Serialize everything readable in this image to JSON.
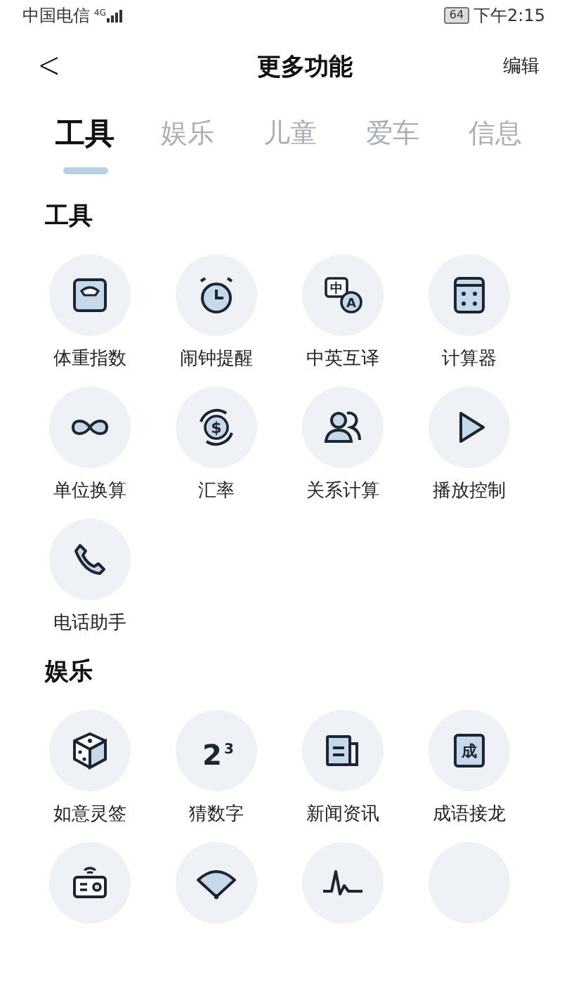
{
  "status_bar": {
    "carrier": "中国电信",
    "network": "4G",
    "battery": "64",
    "time": "下午2:15"
  },
  "header": {
    "back": "<",
    "title": "更多功能",
    "action": "编辑"
  },
  "tabs": [
    {
      "label": "工具",
      "selected": true
    },
    {
      "label": "娱乐",
      "selected": false
    },
    {
      "label": "儿童",
      "selected": false
    },
    {
      "label": "爱车",
      "selected": false
    },
    {
      "label": "信息",
      "selected": false
    }
  ],
  "sections": [
    {
      "title": "工具",
      "items": [
        {
          "kind": "scale",
          "label": "体重指数"
        },
        {
          "kind": "alarm",
          "label": "闹钟提醒"
        },
        {
          "kind": "translate",
          "label": "中英互译",
          "glyphs": [
            "中",
            "A"
          ]
        },
        {
          "kind": "calculator",
          "label": "计算器"
        },
        {
          "kind": "infinity",
          "label": "单位换算"
        },
        {
          "kind": "currency",
          "label": "汇率",
          "glyphs": [
            "$"
          ]
        },
        {
          "kind": "people",
          "label": "关系计算"
        },
        {
          "kind": "play",
          "label": "播放控制"
        },
        {
          "kind": "phone",
          "label": "电话助手"
        }
      ]
    },
    {
      "title": "娱乐",
      "items": [
        {
          "kind": "dice",
          "label": "如意灵签"
        },
        {
          "kind": "numbers",
          "label": "猜数字",
          "glyphs": [
            "2",
            "3"
          ]
        },
        {
          "kind": "news",
          "label": "新闻资讯"
        },
        {
          "kind": "idiom",
          "label": "成语接龙",
          "glyphs": [
            "成"
          ]
        },
        {
          "kind": "radio"
        },
        {
          "kind": "fan"
        },
        {
          "kind": "wave"
        },
        {
          "kind": "blank"
        }
      ]
    }
  ]
}
